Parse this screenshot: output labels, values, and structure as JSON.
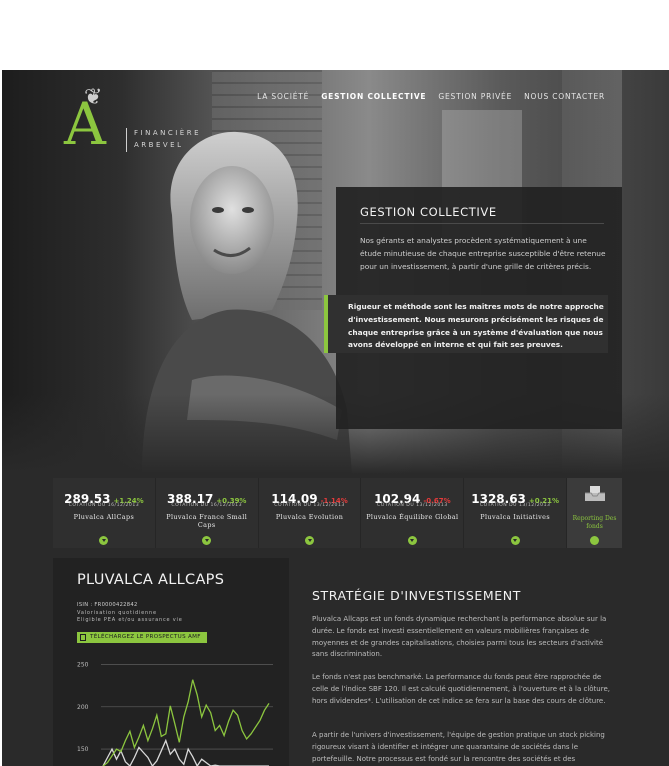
{
  "brand": {
    "logo_letter": "A",
    "name_line1": "FINANCIÈRE",
    "name_line2": "ARBEVEL",
    "accent_color": "#8cc63f"
  },
  "nav": {
    "items": [
      {
        "label": "LA SOCIÉTÉ",
        "active": false
      },
      {
        "label": "GESTION COLLECTIVE",
        "active": true
      },
      {
        "label": "GESTION PRIVÉE",
        "active": false
      },
      {
        "label": "NOUS CONTACTER",
        "active": false
      }
    ]
  },
  "hero": {
    "title": "GESTION COLLECTIVE",
    "intro": "Nos gérants et analystes procèdent systématiquement à une étude minutieuse de chaque entreprise susceptible d'être retenue pour un investissement, à partir d'une grille de critères précis.",
    "quote": "Rigueur et méthode sont les maîtres mots de notre approche d'investissement. Nous mesurons précisément les risques de chaque entreprise grâce à un système d'évaluation que nous avons développé en interne et qui fait ses preuves."
  },
  "funds": [
    {
      "value": "289.53",
      "change": "+1.24%",
      "direction": "up",
      "date": "COTATION DU 16/12/2013",
      "name": "Pluvalca AllCaps"
    },
    {
      "value": "388.17",
      "change": "+0.39%",
      "direction": "up",
      "date": "COTATION DU 16/12/2013",
      "name": "Pluvalca France Small Caps"
    },
    {
      "value": "114.09",
      "change": "-1.14%",
      "direction": "down",
      "date": "COTATION DU 13/12/2013",
      "name": "Pluvalca Evolution"
    },
    {
      "value": "102.94",
      "change": "-0.67%",
      "direction": "down",
      "date": "COTATION DU 13/12/2013",
      "name": "Pluvalca Équilibre Global"
    },
    {
      "value": "1328.63",
      "change": "+0.21%",
      "direction": "up",
      "date": "COTATION DU 13/12/2013",
      "name": "Pluvalca Initiatives"
    }
  ],
  "reporting": {
    "label": "Reporting Des fonds",
    "icon": "document-tray-icon"
  },
  "fund_detail": {
    "title": "PLUVALCA ALLCAPS",
    "isin": "ISIN : FR0000422842",
    "valuation": "Valorisation quotidienne",
    "eligibility": "Eligible PEA et/ou assurance vie",
    "download_label": "TÉLÉCHARGEZ LE PROSPECTUS AMF"
  },
  "strategy": {
    "title": "STRATÉGIE D'INVESTISSEMENT",
    "paragraphs": [
      "Pluvalca Allcaps est un fonds dynamique recherchant la performance absolue sur la durée. Le fonds est investi essentiellement en valeurs mobilières françaises de moyennes et de grandes capitalisations, choisies parmi tous les secteurs d'activité sans discrimination.",
      "Le fonds n'est pas benchmarké. La performance du fonds peut être rapprochée de celle de l'indice SBF 120. Il est calculé quotidiennement, à l'ouverture et à la clôture, hors dividendes*. L'utilisation de cet indice se fera sur la base des cours de clôture.",
      "A partir de l'univers d'investissement, l'équipe de gestion pratique un stock picking rigoureux visant à identifier et intégrer une quarantaine de sociétés dans le portefeuille. Notre processus est fondé sur la rencontre des sociétés et des"
    ]
  },
  "chart_data": {
    "type": "line",
    "ylim": [
      130,
      260
    ],
    "yticks": [
      150,
      200,
      250
    ],
    "series": [
      {
        "color": "#8cc63f",
        "values": [
          130,
          134,
          142,
          150,
          147,
          160,
          171,
          152,
          164,
          178,
          160,
          174,
          190,
          165,
          168,
          201,
          180,
          158,
          188,
          206,
          232,
          214,
          188,
          202,
          193,
          172,
          178,
          166,
          183,
          196,
          190,
          172,
          162,
          168,
          176,
          184,
          196,
          204
        ]
      },
      {
        "color": "#d9d9d9",
        "values": [
          130,
          140,
          150,
          138,
          148,
          135,
          130,
          140,
          152,
          146,
          140,
          130,
          136,
          148,
          160,
          144,
          150,
          138,
          132,
          150,
          141,
          130,
          138,
          134,
          130,
          131,
          130,
          130,
          130,
          130,
          130,
          130,
          130,
          130,
          130,
          130,
          130,
          130
        ]
      }
    ]
  }
}
